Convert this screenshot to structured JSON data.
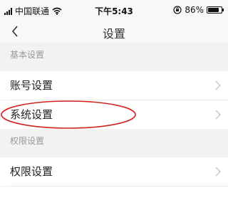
{
  "status_bar": {
    "carrier": "中国联通",
    "time": "下午5:43",
    "battery": "86%",
    "battery_level": 0.86
  },
  "nav": {
    "title": "设置"
  },
  "sections": [
    {
      "title": "基本设置",
      "items": [
        {
          "label": "账号设置"
        },
        {
          "label": "系统设置"
        }
      ]
    },
    {
      "title": "权限设置",
      "items": [
        {
          "label": "权限设置"
        }
      ]
    }
  ],
  "annotation": {
    "color": "#d0231c"
  }
}
